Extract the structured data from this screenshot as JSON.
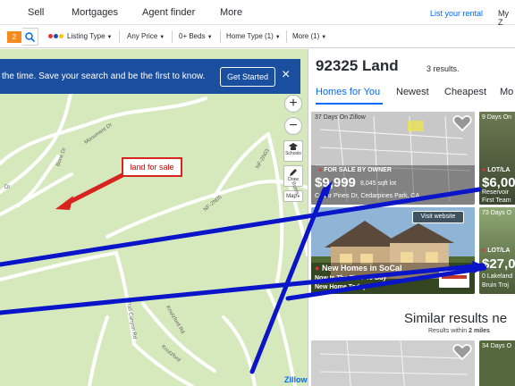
{
  "nav": {
    "sell": "Sell",
    "mortgages": "Mortgages",
    "agent_finder": "Agent finder",
    "more": "More",
    "list_rental": "List your rental",
    "my_zillow": "My Z"
  },
  "filters": {
    "search_count": "2",
    "listing_type": "Listing Type",
    "any_price": "Any Price",
    "beds": "0+ Beds",
    "home_type": "Home Type (1)",
    "more": "More (1)"
  },
  "map": {
    "banner_text": "the time. Save your search and be the first to know.",
    "get_started": "Get Started",
    "close": "×",
    "zoom_in": "+",
    "zoom_out": "−",
    "schools": "Schools",
    "draw": "Draw",
    "map_type": "Map",
    "callout": "land for sale",
    "streets": {
      "monument": "Monument Dr",
      "bone": "Bone Dr",
      "nf2n03": "NF-2N03",
      "nf2n05": "NF-2N05",
      "burris": "Burris",
      "dr": "Dr",
      "knutzford_rd": "Knutzford Rd",
      "skyland": "Skyland Dr",
      "trail": "Trail Canyon Rd",
      "knutzford": "Knutzford"
    },
    "logo": "Zillow"
  },
  "results": {
    "title": "92325 Land",
    "count": "3 results.",
    "tabs": [
      "Homes for You",
      "Newest",
      "Cheapest",
      "Mo"
    ],
    "cards": [
      {
        "days": "37 Days On Zillow",
        "status": "FOR SALE BY OWNER",
        "price": "$9,999",
        "size": "8,045 sqft lot",
        "address": "Cedar Pines Dr, Cedarpines Park, CA"
      },
      {
        "days": "9 Days On",
        "status": "LOT/LA",
        "price": "$6,00",
        "address": "Reservoir",
        "broker": "First Team"
      },
      {
        "visit": "Visit website",
        "title": "New Homes in SoCal",
        "sub": "Now Is The Time To Buy",
        "tour": "New Home Today"
      },
      {
        "days": "73 Days O",
        "status": "LOT/LA",
        "price": "$27,0",
        "address": "0 Lakeland",
        "broker": "Bruin Troj"
      }
    ],
    "similar": "Similar results ne",
    "within_prefix": "Results within",
    "within_value": "2 miles",
    "similar_card_days": "34 Days O"
  },
  "colors": {
    "accent": "#006aff",
    "map_bg": "#d5e9bd",
    "annotation_blue": "#0a14c8",
    "callout_red": "#d8241f",
    "status_red": "#e5313a"
  }
}
